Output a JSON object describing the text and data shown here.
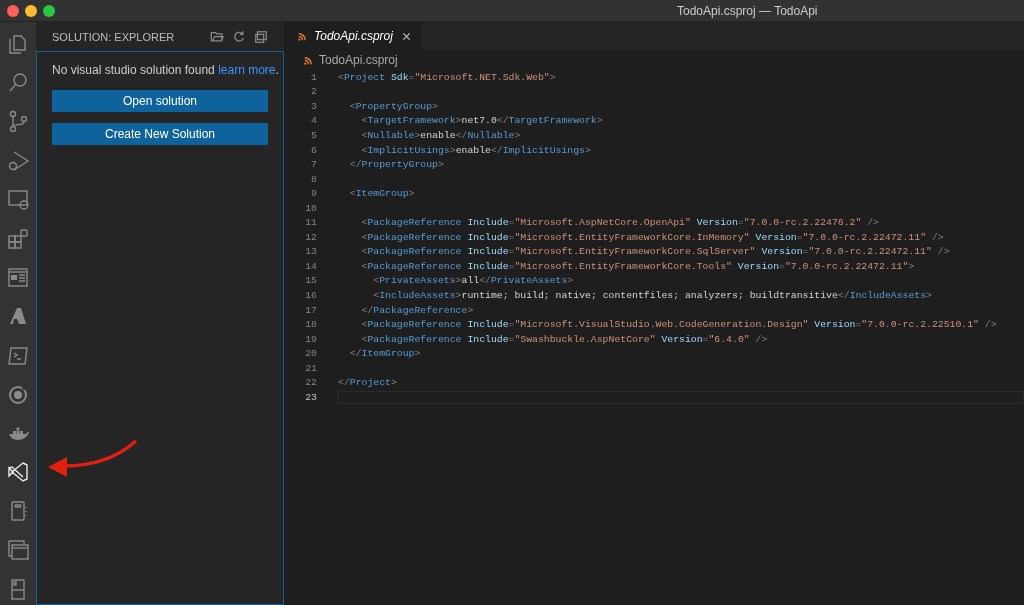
{
  "window": {
    "title": "TodoApi.csproj — TodoApi"
  },
  "activity_bar": [
    {
      "kind": "files",
      "selected": false
    },
    {
      "kind": "search",
      "selected": false
    },
    {
      "kind": "source-control",
      "selected": false
    },
    {
      "kind": "debug",
      "selected": false
    },
    {
      "kind": "remote",
      "selected": false
    },
    {
      "kind": "extensions",
      "selected": false
    },
    {
      "kind": "browser",
      "selected": false
    },
    {
      "kind": "azure",
      "selected": false
    },
    {
      "kind": "terminal",
      "selected": false
    },
    {
      "kind": "ring",
      "selected": false
    },
    {
      "kind": "whale",
      "selected": false
    },
    {
      "kind": "vs",
      "selected": true
    },
    {
      "kind": "notebook",
      "selected": false
    },
    {
      "kind": "windows",
      "selected": false
    },
    {
      "kind": "device",
      "selected": false
    }
  ],
  "sidebar": {
    "title": "SOLUTION: EXPLORER",
    "message": "No visual studio solution found",
    "link": "learn more",
    "link_end": ".",
    "buttons": [
      "Open solution",
      "Create New Solution"
    ]
  },
  "tabs": [
    {
      "label": "TodoApi.csproj",
      "selected": true
    }
  ],
  "breadcrumb": "TodoApi.csproj",
  "editor": {
    "lines": [
      {
        "number": "1",
        "text": "<Project Sdk=\"Microsoft.NET.Sdk.Web\">",
        "current": false
      },
      {
        "number": "2",
        "current": false
      },
      {
        "number": "3",
        "text": "  <PropertyGroup>",
        "current": false
      },
      {
        "number": "4",
        "text": "    <TargetFramework>net7.0</TargetFramework>",
        "current": false
      },
      {
        "number": "5",
        "text": "    <Nullable>enable</Nullable>",
        "current": false
      },
      {
        "number": "6",
        "text": "    <ImplicitUsings>enable</ImplicitUsings>",
        "current": false
      },
      {
        "number": "7",
        "text": "  </PropertyGroup>",
        "current": false
      },
      {
        "number": "8",
        "current": false
      },
      {
        "number": "9",
        "text": "  <ItemGroup>",
        "current": false
      },
      {
        "number": "10",
        "current": false
      },
      {
        "number": "11",
        "text": "    <PackageReference Include=\"Microsoft.AspNetCore.OpenApi\" Version=\"7.0.0-rc.2.22476.2\" />",
        "current": false
      },
      {
        "number": "12",
        "text": "    <PackageReference Include=\"Microsoft.EntityFrameworkCore.InMemory\" Version=\"7.0.0-rc.2.22472.11\" />",
        "current": false
      },
      {
        "number": "13",
        "text": "    <PackageReference Include=\"Microsoft.EntityFrameworkCore.SqlServer\" Version=\"7.0.0-rc.2.22472.11\" />",
        "current": false
      },
      {
        "number": "14",
        "text": "    <PackageReference Include=\"Microsoft.EntityFrameworkCore.Tools\" Version=\"7.0.0-rc.2.22472.11\">",
        "current": false
      },
      {
        "number": "15",
        "text": "      <PrivateAssets>all</PrivateAssets>",
        "current": false
      },
      {
        "number": "16",
        "text": "      <IncludeAssets>runtime; build; native; contentfiles; analyzers; buildtransitive</IncludeAssets>",
        "current": false
      },
      {
        "number": "17",
        "text": "    </PackageReference>",
        "current": false
      },
      {
        "number": "18",
        "text": "    <PackageReference Include=\"Microsoft.VisualStudio.Web.CodeGeneration.Design\" Version=\"7.0.0-rc.2.22510.1\" />",
        "current": false
      },
      {
        "number": "19",
        "text": "    <PackageReference Include=\"Swashbuckle.AspNetCore\" Version=\"6.4.0\" />",
        "current": false
      },
      {
        "number": "20",
        "text": "  </ItemGroup>",
        "current": false
      },
      {
        "number": "21",
        "current": false
      },
      {
        "number": "22",
        "text": "</Project>",
        "current": false
      },
      {
        "number": "23",
        "current": true
      }
    ]
  }
}
